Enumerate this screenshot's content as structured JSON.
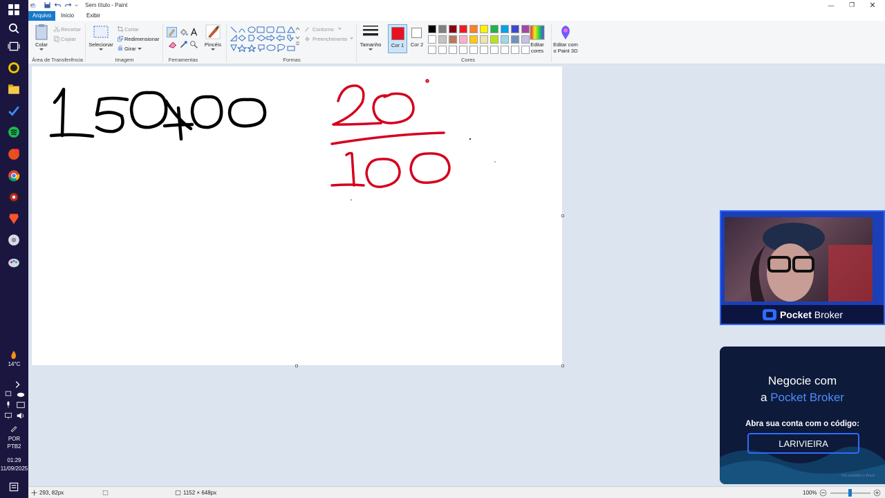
{
  "window": {
    "title": "Sem título - Paint"
  },
  "menu": {
    "tabs": [
      "Arquivo",
      "Início",
      "Exibir"
    ]
  },
  "ribbon": {
    "clipboard": {
      "paste": "Colar",
      "cut": "Recortar",
      "copy": "Copiar",
      "label": "Área de Transferência"
    },
    "image": {
      "select": "Selecionar",
      "crop": "Cortar",
      "resize": "Redimensionar",
      "rotate": "Girar",
      "label": "Imagem"
    },
    "tools": {
      "label": "Ferramentas"
    },
    "brushes": {
      "label": "Pincéis"
    },
    "shapes": {
      "outline": "Contorno",
      "fill": "Preenchimento",
      "label": "Formas"
    },
    "size": {
      "label": "Tamanho"
    },
    "colors": {
      "color1": "Cor 1",
      "color2": "Cor 2",
      "edit": "Editar cores",
      "edit3d": "Editar com o Paint 3D",
      "label": "Cores",
      "color1_value": "#e81123",
      "color2_value": "#ffffff",
      "palette_row1": [
        "#000000",
        "#7f7f7f",
        "#880015",
        "#ed1c24",
        "#ff7f27",
        "#fff200",
        "#22b14c",
        "#00a2e8",
        "#3f48cc",
        "#a349a4"
      ],
      "palette_row2": [
        "#ffffff",
        "#c3c3c3",
        "#b97a57",
        "#ffaec9",
        "#ffc90e",
        "#efe4b0",
        "#b5e61d",
        "#99d9ea",
        "#7092be",
        "#c8bfe7"
      ]
    }
  },
  "status": {
    "cursor_pos": "293, 82px",
    "canvas_size": "1152 × 648px",
    "zoom": "100%"
  },
  "taskbar": {
    "temperature": "14°C",
    "lang1": "POR",
    "lang2": "PTB2",
    "time": "01:29",
    "date": "11/09/2025"
  },
  "webcam": {
    "brand_bold": "Pocket",
    "brand_rest": " Broker"
  },
  "promo": {
    "line1": "Negocie com",
    "line2_prefix": "a ",
    "line2_brand": "Pocket Broker",
    "cta": "Abra sua conta com o código:",
    "code": "LARIVIEIRA",
    "footnote": "Not available in Brazil"
  }
}
